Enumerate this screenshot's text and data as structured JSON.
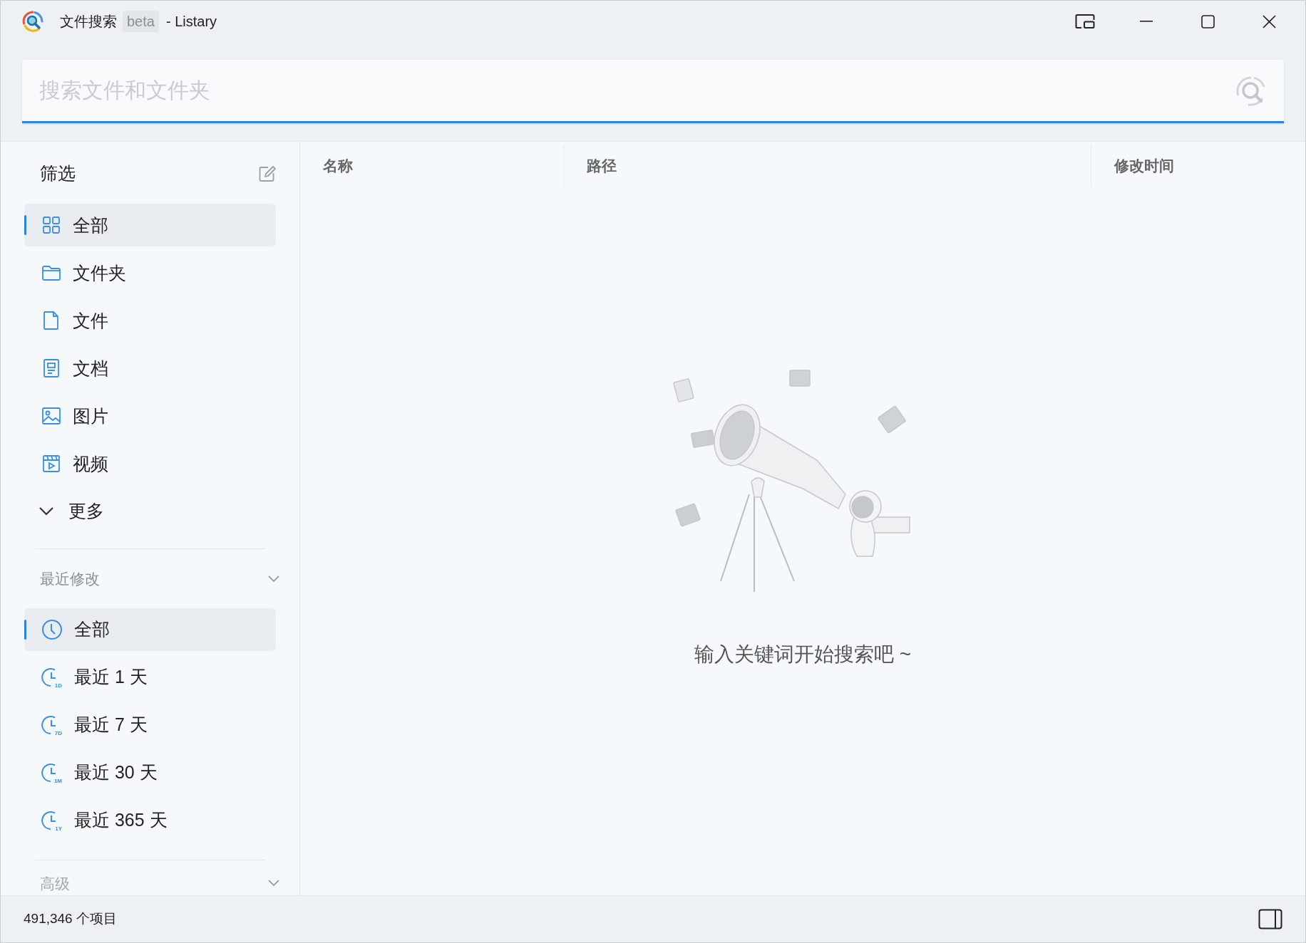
{
  "window": {
    "title": "文件搜索",
    "badge": "beta",
    "subtitle": "- Listary"
  },
  "search": {
    "placeholder": "搜索文件和文件夹"
  },
  "sidebar": {
    "filter_title": "筛选",
    "filters": [
      {
        "kind": "grid",
        "label": "全部",
        "selected": true
      },
      {
        "kind": "folder",
        "label": "文件夹",
        "selected": false
      },
      {
        "kind": "file",
        "label": "文件",
        "selected": false
      },
      {
        "kind": "document",
        "label": "文档",
        "selected": false
      },
      {
        "kind": "image",
        "label": "图片",
        "selected": false
      },
      {
        "kind": "video",
        "label": "视频",
        "selected": false
      }
    ],
    "more": "更多",
    "recent_title": "最近修改",
    "recent": [
      {
        "label": "全部",
        "selected": true
      },
      {
        "label": "最近 1 天",
        "icon_label": "1D",
        "selected": false
      },
      {
        "label": "最近 7 天",
        "icon_label": "7D",
        "selected": false
      },
      {
        "label": "最近 30 天",
        "icon_label": "1M",
        "selected": false
      },
      {
        "label": "最近 365 天",
        "icon_label": "1Y",
        "selected": false
      }
    ],
    "advanced_title": "高级"
  },
  "table": {
    "columns": [
      "名称",
      "路径",
      "修改时间"
    ]
  },
  "empty_state": {
    "message": "输入关键词开始搜索吧 ~"
  },
  "status_bar": {
    "count": "491,346 个项目"
  }
}
